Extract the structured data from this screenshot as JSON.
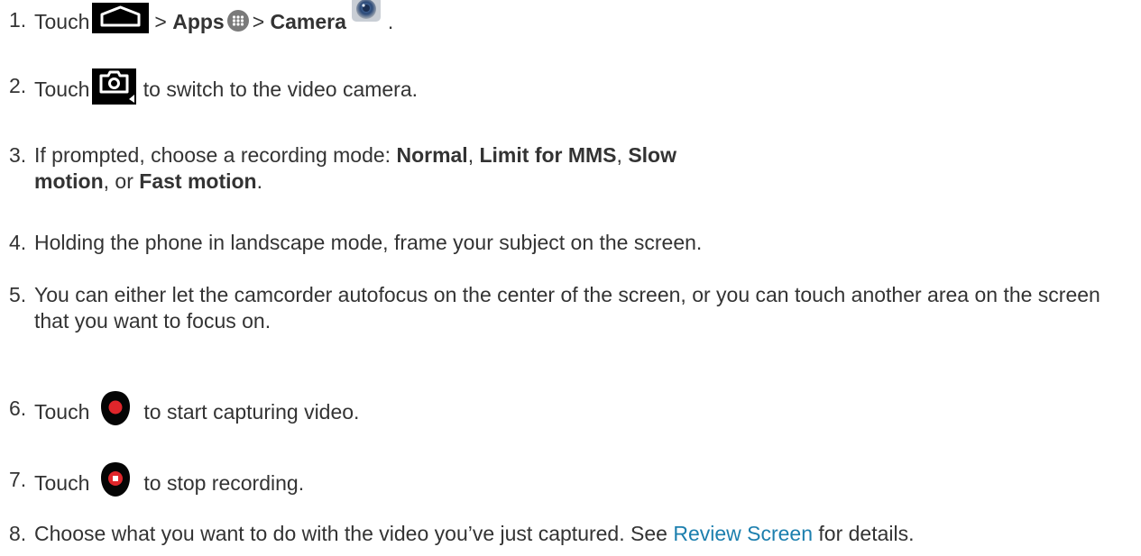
{
  "steps": [
    {
      "num": "1.",
      "touch": "Touch",
      "sep1": ">",
      "apps": "Apps",
      "sep2": ">",
      "camera": "Camera",
      "end": "."
    },
    {
      "num": "2.",
      "touch": "Touch",
      "rest": "to switch to the video camera."
    },
    {
      "num": "3.",
      "pre": "If prompted, choose a recording mode: ",
      "mode1": "Normal",
      "c1": ", ",
      "mode2": "Limit for MMS",
      "c2": ", ",
      "mode3": "Slow motion",
      "c3": ", or ",
      "mode4": "Fast motion",
      "end": "."
    },
    {
      "num": "4.",
      "text": "Holding the phone in landscape mode, frame your subject on the screen."
    },
    {
      "num": "5.",
      "text": "You can either let the camcorder autofocus on the center of the screen, or you can touch another area on the screen that you want to focus on."
    },
    {
      "num": "6.",
      "touch": "Touch",
      "rest": "to start capturing video."
    },
    {
      "num": "7.",
      "touch": "Touch",
      "rest": "to stop recording."
    },
    {
      "num": "8.",
      "pre": "Choose what you want to do with the video you’ve just captured. See ",
      "link": "Review Screen",
      "post": " for details."
    }
  ],
  "icons": {
    "home": "home-icon",
    "apps": "apps-grid-icon",
    "camera_app": "camera-app-icon",
    "switch_video": "camera-switch-icon",
    "record_start": "record-icon",
    "record_stop": "stop-record-icon"
  },
  "colors": {
    "text": "#333333",
    "link": "#1c7fae",
    "record_red": "#e0262b"
  }
}
